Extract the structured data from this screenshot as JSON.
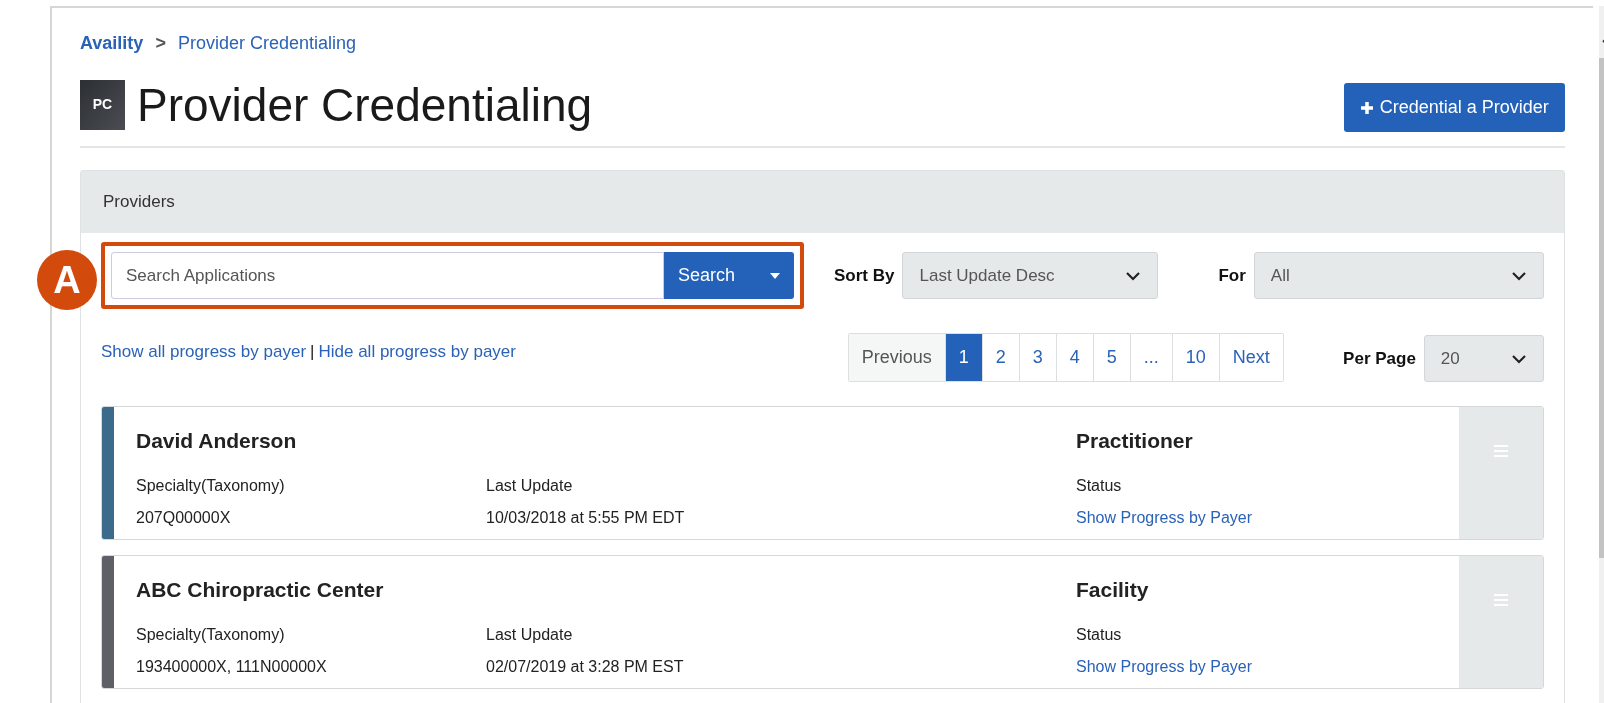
{
  "breadcrumb": [
    {
      "label": "Availity",
      "bold": true
    },
    {
      "label": "Provider Credentialing",
      "bold": false
    }
  ],
  "breadcrumb_separator": ">",
  "page": {
    "icon_text": "PC",
    "title": "Provider Credentialing",
    "action_button": "Credential a Provider"
  },
  "panel": {
    "title": "Providers"
  },
  "callout": {
    "letter": "A"
  },
  "search": {
    "placeholder": "Search Applications",
    "button": "Search"
  },
  "sort": {
    "label": "Sort By",
    "value": "Last Update Desc"
  },
  "filter": {
    "label": "For",
    "value": "All"
  },
  "progress_links": [
    {
      "label": "Show all progress by payer"
    },
    {
      "label": "Hide all progress by payer"
    }
  ],
  "progress_links_separator": "|",
  "pagination": [
    {
      "label": "Previous",
      "selected": false
    },
    {
      "label": "1",
      "selected": true
    },
    {
      "label": "2",
      "selected": false
    },
    {
      "label": "3",
      "selected": false
    },
    {
      "label": "4",
      "selected": false
    },
    {
      "label": "5",
      "selected": false
    },
    {
      "label": "...",
      "selected": false
    },
    {
      "label": "10",
      "selected": false
    },
    {
      "label": "Next",
      "selected": false
    }
  ],
  "per_page": {
    "label": "Per Page",
    "value": "20"
  },
  "providers": [
    {
      "name": "David Anderson",
      "color": "#3c6a8b",
      "specialty_label": "Specialty(Taxonomy)",
      "specialty": "207Q00000X",
      "update_label": "Last Update",
      "update": "10/03/2018 at 5:55 PM EDT",
      "type": "Practitioner",
      "status_label": "Status",
      "status_link": "Show Progress by Payer"
    },
    {
      "name": "ABC Chiropractic Center",
      "color": "#5f6067",
      "specialty_label": "Specialty(Taxonomy)",
      "specialty": "193400000X, 111N00000X",
      "update_label": "Last Update",
      "update": "02/07/2019 at 3:28 PM EST",
      "type": "Facility",
      "status_label": "Status",
      "status_link": "Show Progress by Payer"
    }
  ]
}
